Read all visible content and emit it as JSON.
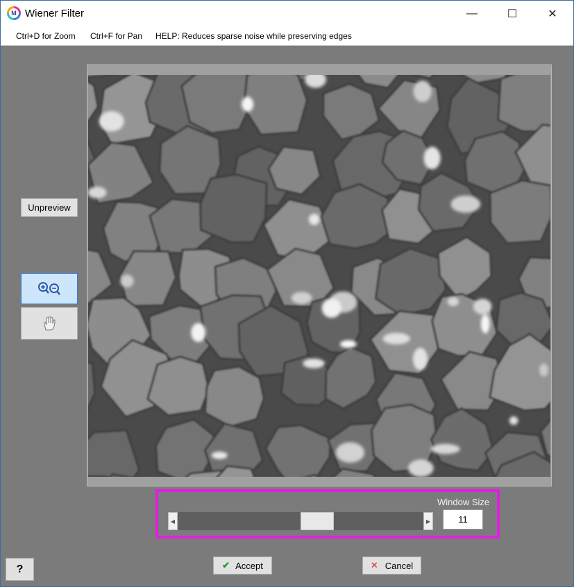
{
  "window": {
    "title": "Wiener Filter",
    "controls": {
      "minimize": "—",
      "maximize": "☐",
      "close": "✕"
    }
  },
  "menu": {
    "zoom_hint": "Ctrl+D for Zoom",
    "pan_hint": "Ctrl+F for Pan",
    "help": "HELP:  Reduces sparse noise while preserving edges"
  },
  "left_panel": {
    "unpreview_label": "Unpreview",
    "zoom_tool_icon": "zoom-in-out-icon",
    "pan_tool_icon": "hand-pan-icon",
    "active_tool": "zoom"
  },
  "window_size": {
    "label": "Window Size",
    "value": "11",
    "slider_position": 0.58
  },
  "buttons": {
    "accept_icon": "✔",
    "accept": "Accept",
    "cancel_icon": "✕",
    "cancel": "Cancel",
    "help": "?"
  },
  "colors": {
    "highlight": "#e020e0",
    "accept_check": "#1f9a1f",
    "cancel_x": "#d62828",
    "active_tool_bg": "#cde6fb",
    "active_tool_border": "#2f7fd6"
  }
}
